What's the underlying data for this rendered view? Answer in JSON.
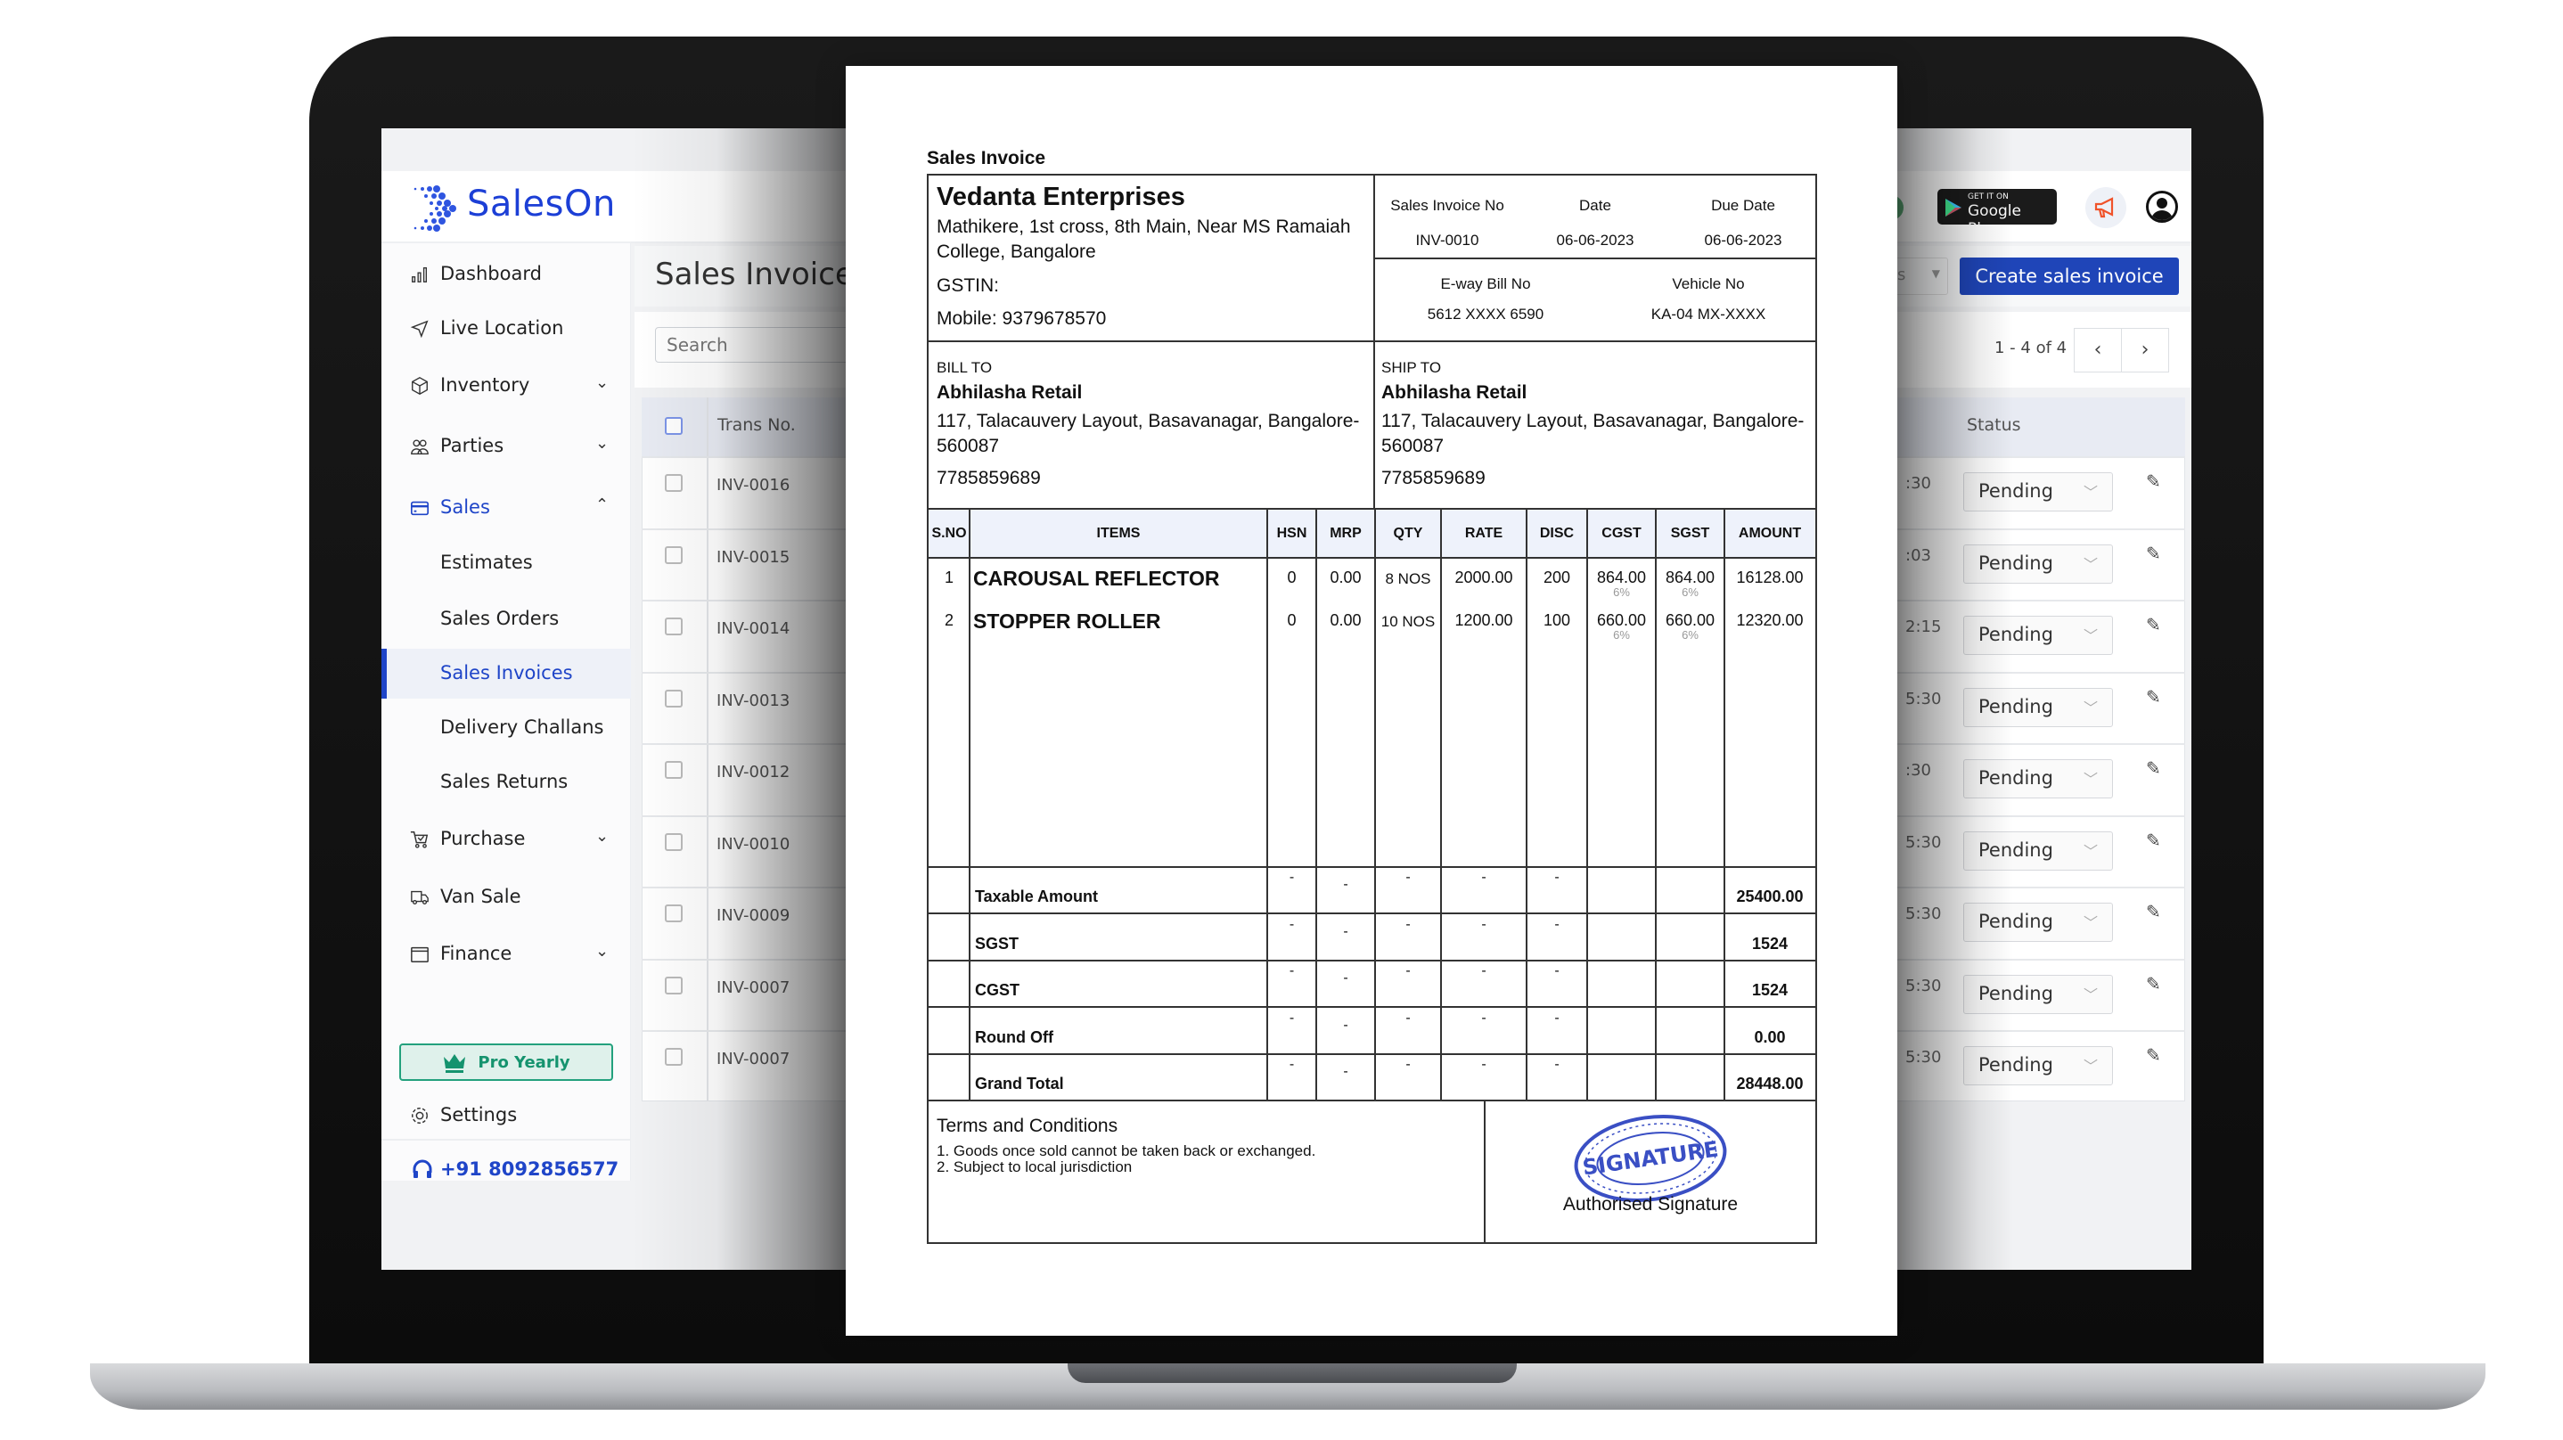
{
  "sidebar": {
    "logo": "SalesOn",
    "items": [
      {
        "label": "Dashboard",
        "icon": "bar-chart-icon"
      },
      {
        "label": "Live Location",
        "icon": "navigation-icon"
      },
      {
        "label": "Inventory",
        "icon": "box-icon",
        "chevron": "⌄"
      },
      {
        "label": "Parties",
        "icon": "users-icon",
        "chevron": "⌄"
      },
      {
        "label": "Sales",
        "icon": "card-icon",
        "chevron": "⌃"
      },
      {
        "label": "Estimates"
      },
      {
        "label": "Sales Orders"
      },
      {
        "label": "Sales Invoices"
      },
      {
        "label": "Delivery Challans"
      },
      {
        "label": "Sales Returns"
      },
      {
        "label": "Purchase",
        "icon": "cart-icon",
        "chevron": "⌄"
      },
      {
        "label": "Van Sale",
        "icon": "truck-icon"
      },
      {
        "label": "Finance",
        "icon": "wallet-icon",
        "chevron": "⌄"
      }
    ],
    "pro_label": "Pro Yearly",
    "settings_label": "Settings",
    "phone": "+91 8092856577",
    "accent": "#1f45c8"
  },
  "header": {
    "gplay_small": "GET IT ON",
    "gplay_big": "Google Play",
    "create_label": "Create sales invoice",
    "filter_partial": "s",
    "pagination": "1 - 4 of 4",
    "prev": "‹",
    "next": "›"
  },
  "main": {
    "title": "Sales Invoice",
    "search_placeholder": "Search",
    "col_trans": "Trans No.",
    "col_status": "Status",
    "rows": [
      {
        "no": "INV-0016",
        "time": ":30",
        "status": "Pending"
      },
      {
        "no": "INV-0015",
        "time": ":03",
        "status": "Pending"
      },
      {
        "no": "INV-0014",
        "time": "2:15",
        "status": "Pending"
      },
      {
        "no": "INV-0013",
        "time": "5:30",
        "status": "Pending"
      },
      {
        "no": "INV-0012",
        "time": ":30",
        "status": "Pending"
      },
      {
        "no": "INV-0010",
        "time": "5:30",
        "status": "Pending"
      },
      {
        "no": "INV-0009",
        "time": "5:30",
        "status": "Pending"
      },
      {
        "no": "INV-0007",
        "time": "5:30",
        "status": "Pending"
      },
      {
        "no": "INV-0007",
        "time": "5:30",
        "status": "Pending"
      }
    ]
  },
  "invoice": {
    "title": "Sales Invoice",
    "company": "Vedanta Enterprises",
    "address1": "Mathikere, 1st cross, 8th Main, Near MS Ramaiah",
    "address2": "College, Bangalore",
    "gstin": "GSTIN:",
    "mobile": "Mobile: 9379678570",
    "meta_labels": [
      "Sales Invoice No",
      "Date",
      "Due Date"
    ],
    "meta_values": [
      "INV-0010",
      "06-06-2023",
      "06-06-2023"
    ],
    "eway_label": "E-way Bill No",
    "eway_value": "5612 XXXX 6590",
    "vehicle_label": "Vehicle No",
    "vehicle_value": "KA-04 MX-XXXX",
    "bill_to": {
      "label": "BILL TO",
      "name": "Abhilasha Retail",
      "addr1": "117, Talacauvery Layout, Basavanagar, Bangalore-",
      "addr2": "560087",
      "phone": "7785859689"
    },
    "ship_to": {
      "label": "SHIP TO",
      "name": "Abhilasha Retail",
      "addr1": "117, Talacauvery Layout, Basavanagar, Bangalore-",
      "addr2": "560087",
      "phone": "7785859689"
    },
    "columns": [
      "S.NO",
      "ITEMS",
      "HSN",
      "MRP",
      "QTY",
      "RATE",
      "DISC",
      "CGST",
      "SGST",
      "AMOUNT"
    ],
    "items": [
      {
        "sno": "1",
        "name": "CAROUSAL REFLECTOR",
        "hsn": "0",
        "mrp": "0.00",
        "qty": "8 NOS",
        "rate": "2000.00",
        "disc": "200",
        "cgst": "864.00",
        "cgst_pct": "6%",
        "sgst": "864.00",
        "sgst_pct": "6%",
        "amount": "16128.00"
      },
      {
        "sno": "2",
        "name": "STOPPER ROLLER",
        "hsn": "0",
        "mrp": "0.00",
        "qty": "10 NOS",
        "rate": "1200.00",
        "disc": "100",
        "cgst": "660.00",
        "cgst_pct": "6%",
        "sgst": "660.00",
        "sgst_pct": "6%",
        "amount": "12320.00"
      }
    ],
    "summary": [
      {
        "label": "Taxable Amount",
        "value": "25400.00"
      },
      {
        "label": "SGST",
        "value": "1524"
      },
      {
        "label": "CGST",
        "value": "1524"
      },
      {
        "label": "Round Off",
        "value": "0.00"
      },
      {
        "label": "Grand Total",
        "value": "28448.00"
      }
    ],
    "dash": "-",
    "terms_title": "Terms and Conditions",
    "terms": [
      "1. Goods once sold cannot be taken back or exchanged.",
      "2. Subject to local jurisdiction"
    ],
    "stamp_text": "SIGNATURE",
    "signature_label": "Authorised Signature",
    "stamp_color": "#3a4fc4"
  }
}
